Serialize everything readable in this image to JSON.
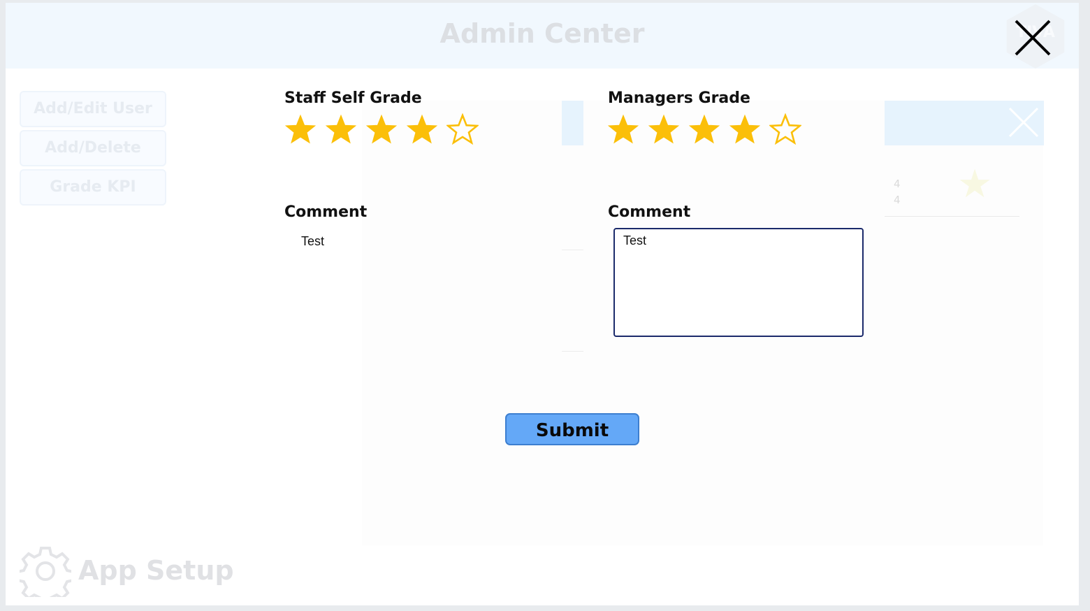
{
  "header": {
    "title": "Admin Center",
    "logo_text": "TIVA"
  },
  "sidebar": {
    "items": [
      {
        "label": "Add/Edit User"
      },
      {
        "label": "Add/Delete KPI's"
      },
      {
        "label": "Grade KPI"
      }
    ],
    "footer_label": "App Setup"
  },
  "background_table": {
    "values": [
      "4",
      "4"
    ]
  },
  "grade_form": {
    "staff": {
      "label": "Staff Self Grade",
      "rating": 4,
      "max_rating": 5,
      "comment_label": "Comment",
      "comment": "Test"
    },
    "manager": {
      "label": "Managers Grade",
      "rating": 4,
      "max_rating": 5,
      "comment_label": "Comment",
      "comment": "Test"
    },
    "submit_label": "Submit"
  },
  "colors": {
    "star": "#fbbf09",
    "submit_bg": "#64a8f7",
    "header_bg": "#f1f8fe",
    "comment_border": "#1b2a6b"
  },
  "icons": {
    "close": "close-icon",
    "star_filled": "star-filled-icon",
    "star_empty": "star-outline-icon",
    "gear": "gear-icon"
  }
}
